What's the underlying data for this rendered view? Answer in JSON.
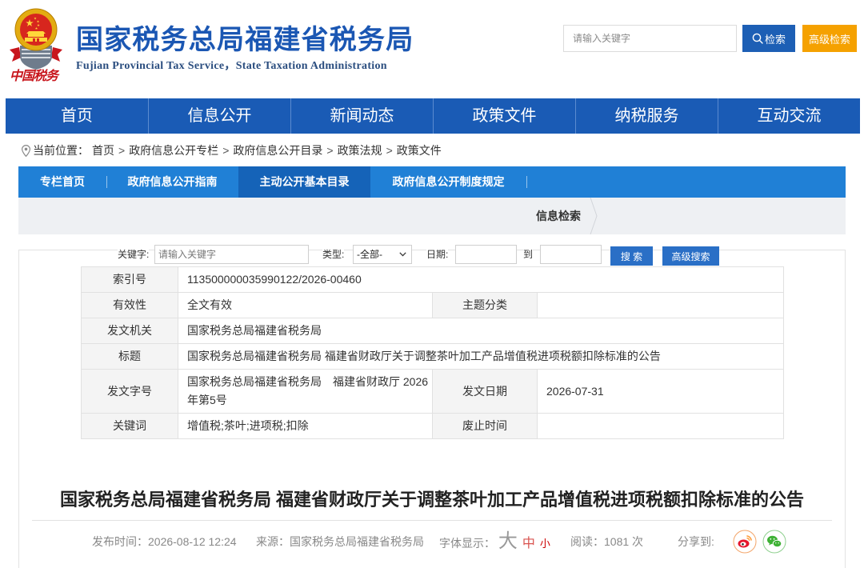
{
  "header": {
    "logo_icon": "national-emblem-icon",
    "logo_lettering": "中国税务",
    "title": "国家税务总局福建省税务局",
    "subtitle": "Fujian Provincial Tax Service，State Taxation Administration",
    "search": {
      "placeholder": "请输入关键字",
      "button_icon": "search-icon",
      "button_label": "检索",
      "advanced_label": "高级检索"
    }
  },
  "nav": {
    "items": [
      "首页",
      "信息公开",
      "新闻动态",
      "政策文件",
      "纳税服务",
      "互动交流"
    ]
  },
  "breadcrumb": {
    "icon": "location-pin-icon",
    "label": "当前位置：",
    "separator": ">",
    "items": [
      "首页",
      "政府信息公开专栏",
      "政府信息公开目录",
      "政策法规",
      "政策文件"
    ]
  },
  "column_tabs": {
    "items": [
      "专栏首页",
      "政府信息公开指南",
      "主动公开基本目录",
      "政府信息公开制度规定"
    ],
    "active": "主动公开基本目录"
  },
  "sub_band": {
    "label": "信息检索",
    "icon": "chevron-right-icon"
  },
  "filter": {
    "keyword_label": "关键字:",
    "keyword_placeholder": "请输入关键字",
    "type_label": "类型:",
    "type_selected": "-全部-",
    "type_icon": "chevron-down-icon",
    "date_label": "日期:",
    "date_to_label": "到",
    "search_button": "搜 索",
    "advanced_button": "高级搜索"
  },
  "document_info": {
    "rows": [
      {
        "label": "索引号",
        "value": "113500000035990122/2026-00460"
      },
      {
        "label": "有效性",
        "value": "全文有效",
        "label2": "主题分类",
        "value2": ""
      },
      {
        "label": "发文机关",
        "value": "国家税务总局福建省税务局"
      },
      {
        "label": "标题",
        "value": "国家税务总局福建省税务局 福建省财政厅关于调整茶叶加工产品增值税进项税额扣除标准的公告"
      },
      {
        "label": "发文字号",
        "value": "国家税务总局福建省税务局　福建省财政厅 2026年第5号",
        "label2": "发文日期",
        "value2": "2026-07-31"
      },
      {
        "label": "关键词",
        "value": "增值税;茶叶;进项税;扣除",
        "label2": "废止时间",
        "value2": ""
      }
    ]
  },
  "article": {
    "title": "国家税务总局福建省税务局 福建省财政厅关于调整茶叶加工产品增值税进项税额扣除标准的公告",
    "publish_label": "发布时间：",
    "publish_time": "2026-08-12 12:24",
    "source_label": "来源：",
    "source": "国家税务总局福建省税务局",
    "font_label": "字体显示：",
    "font_sizes": [
      "大",
      "中",
      "小"
    ],
    "views_label": "阅读：",
    "views": "1081",
    "views_unit": "次",
    "share_label": "分享到:",
    "share_icons": [
      "weibo-icon",
      "wechat-icon"
    ]
  },
  "colors": {
    "brand_blue": "#1a5bb5",
    "title_blue": "#1b57b3",
    "column_tab_blue": "#2080d6",
    "column_tab_active": "#1563b8",
    "advanced_search_orange": "#f5a100",
    "logo_red": "#c8161d"
  }
}
